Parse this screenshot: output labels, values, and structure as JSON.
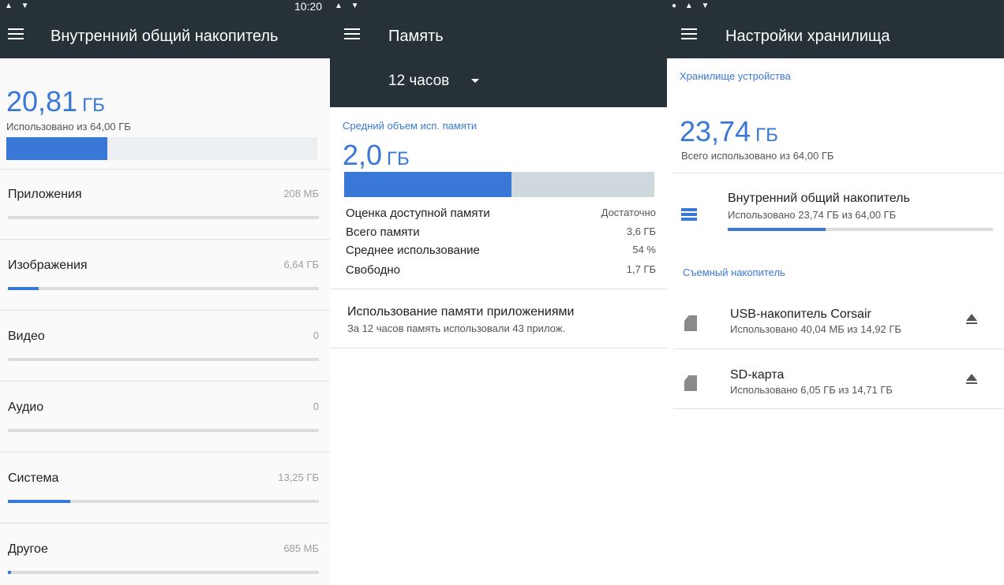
{
  "panel1": {
    "status_time": "10:20",
    "title": "Внутренний общий накопитель",
    "used_value": "20,81",
    "used_unit": "ГБ",
    "used_caption": "Использовано из 64,00 ГБ",
    "used_fraction": 0.325,
    "categories": [
      {
        "label": "Приложения",
        "size": "208 МБ",
        "fraction": 0.0
      },
      {
        "label": "Изображения",
        "size": "6,64 ГБ",
        "fraction": 0.1
      },
      {
        "label": "Видео",
        "size": "0",
        "fraction": 0.0
      },
      {
        "label": "Аудио",
        "size": "0",
        "fraction": 0.0
      },
      {
        "label": "Система",
        "size": "13,25 ГБ",
        "fraction": 0.2
      },
      {
        "label": "Другое",
        "size": "685 МБ",
        "fraction": 0.01
      }
    ]
  },
  "panel2": {
    "title": "Память",
    "period": "12 часов",
    "section_title": "Средний объем исп. памяти",
    "avg_value": "2,0",
    "avg_unit": "ГБ",
    "avg_fraction": 0.54,
    "rows": [
      {
        "key": "Оценка доступной памяти",
        "value": "Достаточно"
      },
      {
        "key": "Всего памяти",
        "value": "3,6 ГБ"
      },
      {
        "key": "Среднее использование",
        "value": "54 %"
      },
      {
        "key": "Свободно",
        "value": "1,7 ГБ"
      }
    ],
    "apps_usage": {
      "title": "Использование памяти приложениями",
      "subtitle": "За 12 часов память использовали 43 прилож."
    }
  },
  "panel3": {
    "title": "Настройки хранилища",
    "device_section": "Хранилище устройства",
    "total_value": "23,74",
    "total_unit": "ГБ",
    "total_caption": "Всего использовано из 64,00 ГБ",
    "internal": {
      "title": "Внутренний общий накопитель",
      "subtitle": "Использовано 23,74 ГБ из 64,00 ГБ",
      "fraction": 0.37
    },
    "removable_section": "Съемный накопитель",
    "removable": [
      {
        "title": "USB-накопитель Corsair",
        "subtitle": "Использовано 40,04 МБ из 14,92 ГБ"
      },
      {
        "title": "SD-карта",
        "subtitle": "Использовано 6,05 ГБ из 14,71 ГБ"
      }
    ]
  },
  "colors": {
    "accent": "#3a78d8",
    "appbar": "#263238"
  }
}
